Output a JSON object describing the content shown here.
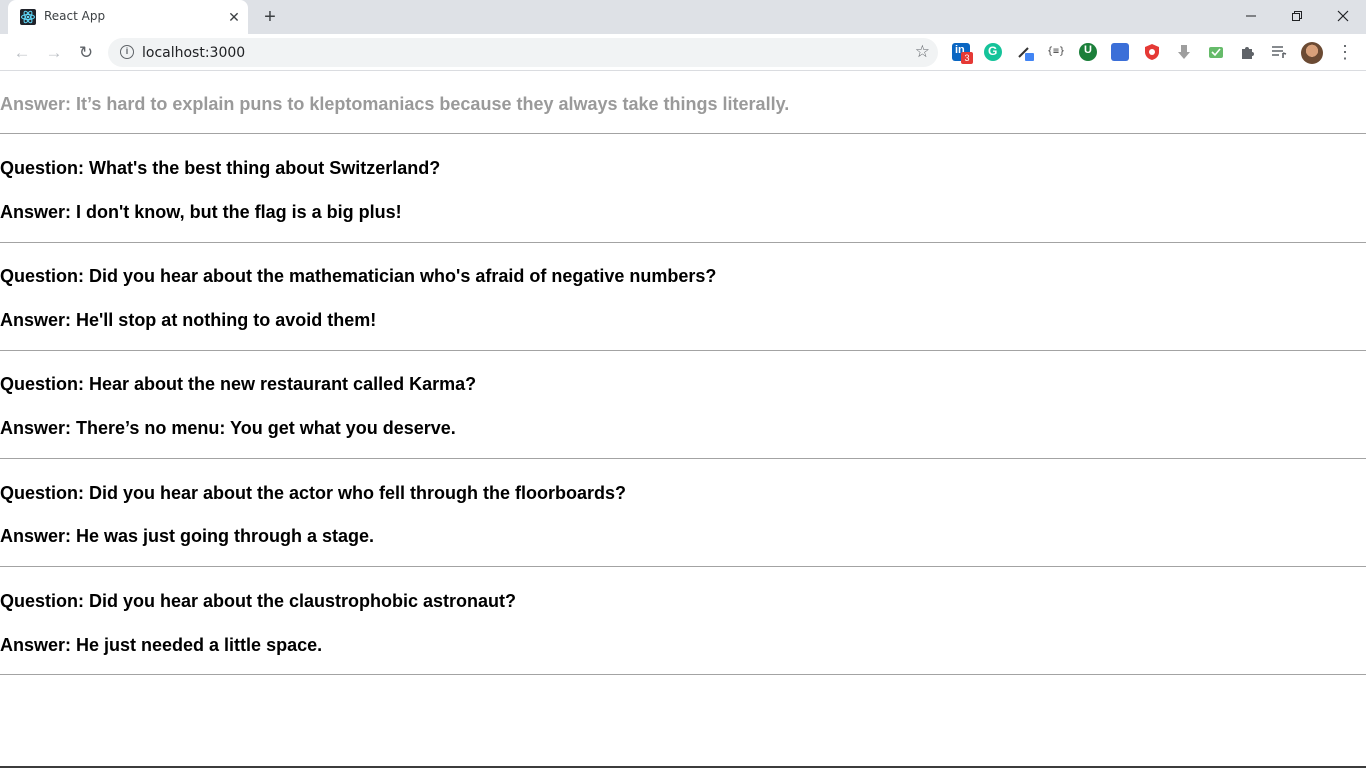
{
  "browser": {
    "tab_title": "React App",
    "url": "localhost:3000",
    "linkedin_badge": "3",
    "ext_json_label": "{≡}"
  },
  "jokes": {
    "partial_answer": "Answer: It’s hard to explain puns to kleptomaniacs because they always take things literally.",
    "items": [
      {
        "question": "Question: What's the best thing about Switzerland?",
        "answer": "Answer: I don't know, but the flag is a big plus!"
      },
      {
        "question": "Question: Did you hear about the mathematician who's afraid of negative numbers?",
        "answer": "Answer: He'll stop at nothing to avoid them!"
      },
      {
        "question": "Question: Hear about the new restaurant called Karma?",
        "answer": "Answer: There’s no menu: You get what you deserve."
      },
      {
        "question": "Question: Did you hear about the actor who fell through the floorboards?",
        "answer": "Answer: He was just going through a stage."
      },
      {
        "question": "Question: Did you hear about the claustrophobic astronaut?",
        "answer": "Answer: He just needed a little space."
      }
    ]
  },
  "colors": {
    "text": "#000000",
    "faded_text": "#9a9a9a",
    "separator": "#a3a3a3"
  }
}
